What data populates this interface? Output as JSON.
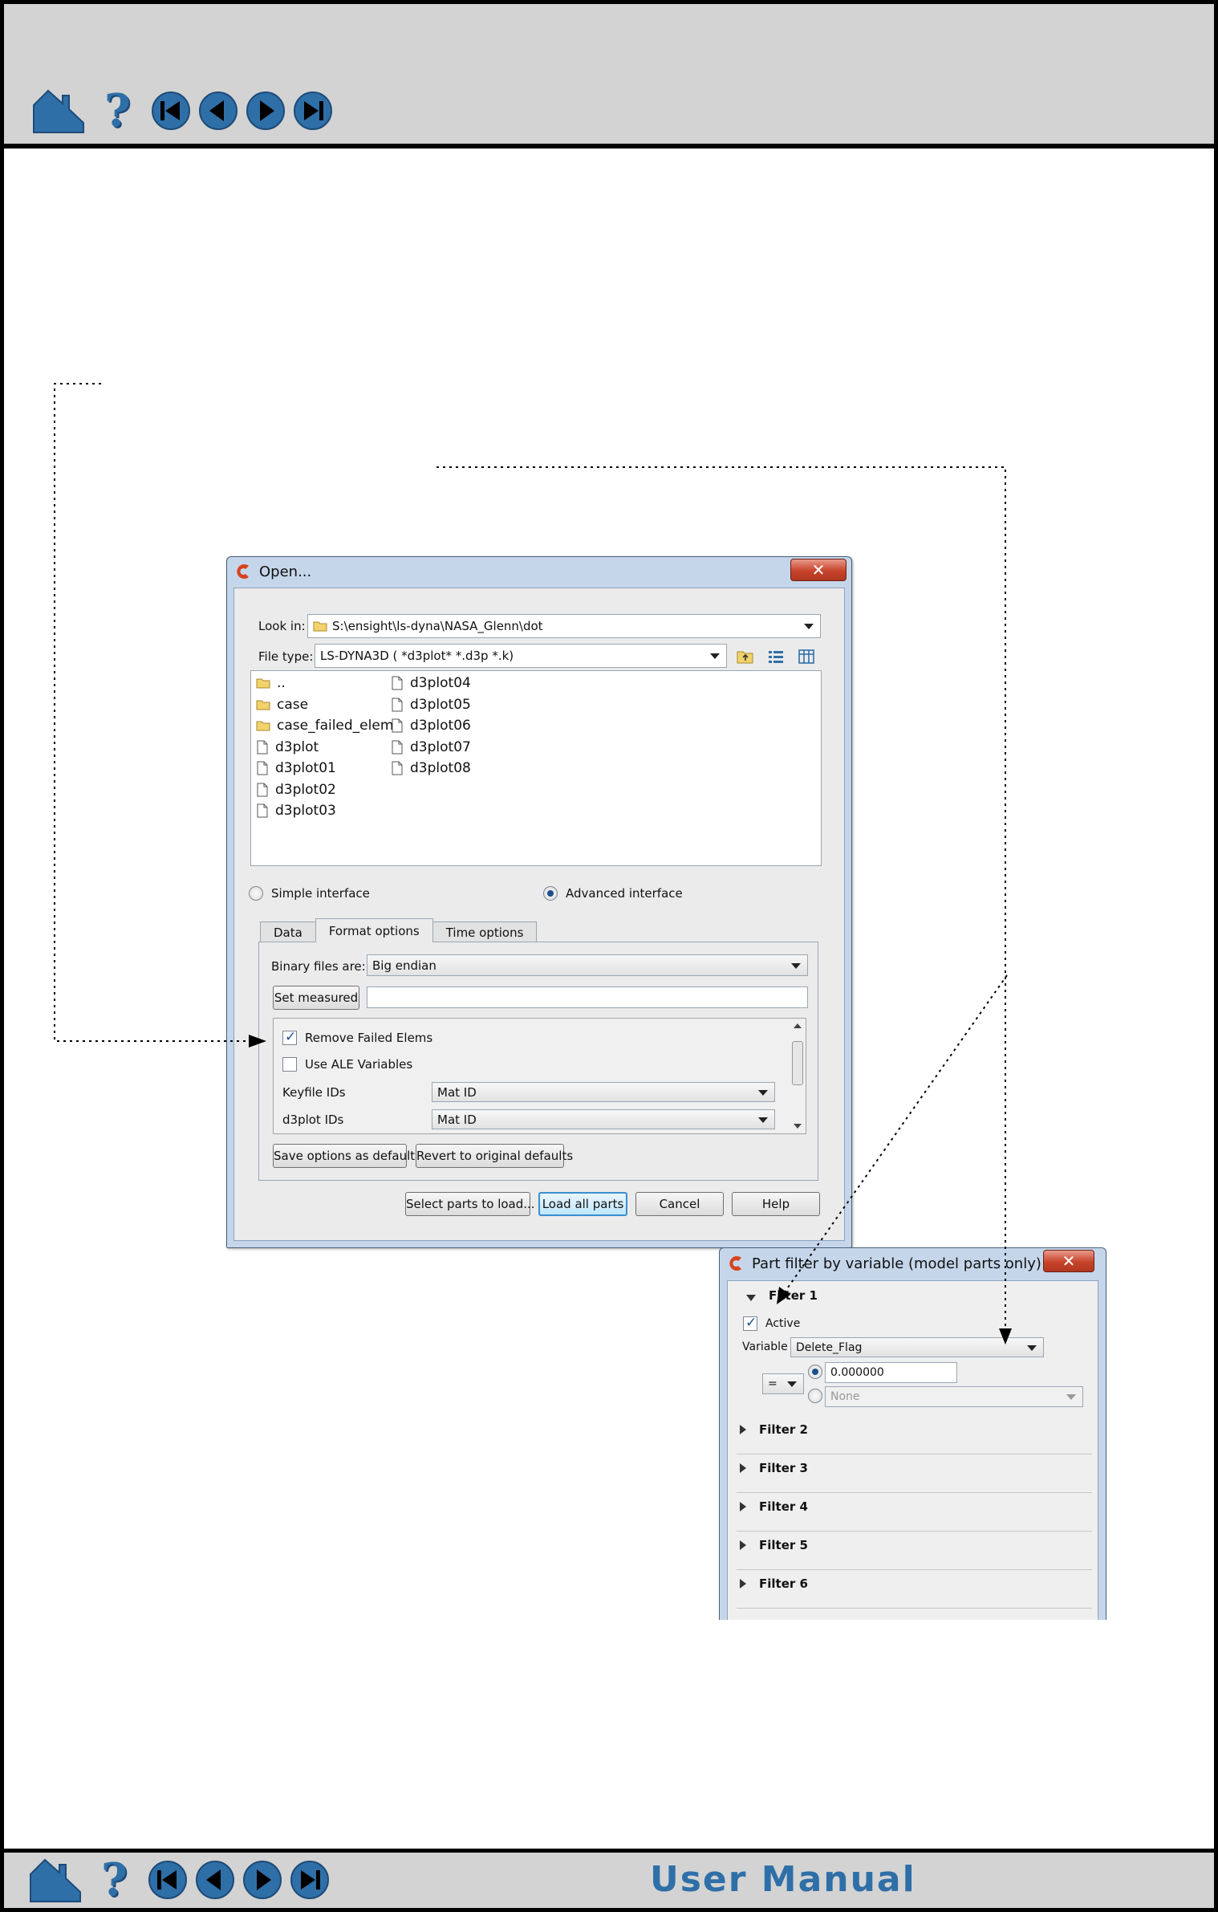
{
  "footer": {
    "manual_title": "User Manual"
  },
  "nav_icons": [
    "home-icon",
    "help-icon",
    "first-page-icon",
    "previous-page-icon",
    "next-page-icon",
    "last-page-icon"
  ],
  "open_dialog": {
    "title": "Open...",
    "close_glyph": "✕",
    "look_in_label": "Look in:",
    "look_in_value": "S:\\ensight\\ls-dyna\\NASA_Glenn\\dot",
    "file_type_label": "File type:",
    "file_type_value": "LS-DYNA3D ( *d3plot* *.d3p *.k)",
    "files_col1": [
      {
        "name": "..",
        "kind": "folder"
      },
      {
        "name": "case",
        "kind": "folder"
      },
      {
        "name": "case_failed_elem",
        "kind": "folder"
      },
      {
        "name": "d3plot",
        "kind": "file"
      },
      {
        "name": "d3plot01",
        "kind": "file"
      },
      {
        "name": "d3plot02",
        "kind": "file"
      },
      {
        "name": "d3plot03",
        "kind": "file"
      }
    ],
    "files_col2": [
      {
        "name": "d3plot04",
        "kind": "file"
      },
      {
        "name": "d3plot05",
        "kind": "file"
      },
      {
        "name": "d3plot06",
        "kind": "file"
      },
      {
        "name": "d3plot07",
        "kind": "file"
      },
      {
        "name": "d3plot08",
        "kind": "file"
      }
    ],
    "simple_interface": "Simple interface",
    "advanced_interface": "Advanced interface",
    "tabs": [
      "Data",
      "Format options",
      "Time options"
    ],
    "active_tab": "Format options",
    "binary_label": "Binary files are:",
    "binary_value": "Big endian",
    "set_measured": "Set measured",
    "set_measured_value": "",
    "remove_failed": "Remove Failed Elems",
    "remove_failed_checked": true,
    "use_ale": "Use ALE Variables",
    "use_ale_checked": false,
    "keyfile_ids_label": "Keyfile IDs",
    "keyfile_ids_value": "Mat ID",
    "d3plot_ids_label": "d3plot IDs",
    "d3plot_ids_value": "Mat ID",
    "save_default": "Save options as default",
    "revert_default": "Revert to original defaults",
    "select_parts": "Select parts to load...",
    "load_all": "Load all parts",
    "cancel": "Cancel",
    "help": "Help"
  },
  "part_filter_dialog": {
    "title": "Part filter by variable (model parts only)",
    "close_glyph": "✕",
    "filter1": "Filter 1",
    "active_label": "Active",
    "active_checked": true,
    "variable_label": "Variable",
    "variable_value": "Delete_Flag",
    "operator": "=",
    "value": "0.000000",
    "none_value": "None",
    "collapsed_filters": [
      "Filter 2",
      "Filter 3",
      "Filter 4",
      "Filter 5",
      "Filter 6"
    ]
  },
  "colors": {
    "accent_blue": "#2f6fa8",
    "chrome_gray": "#d3d3d3",
    "dialog_frame": "#c5d6ea"
  }
}
